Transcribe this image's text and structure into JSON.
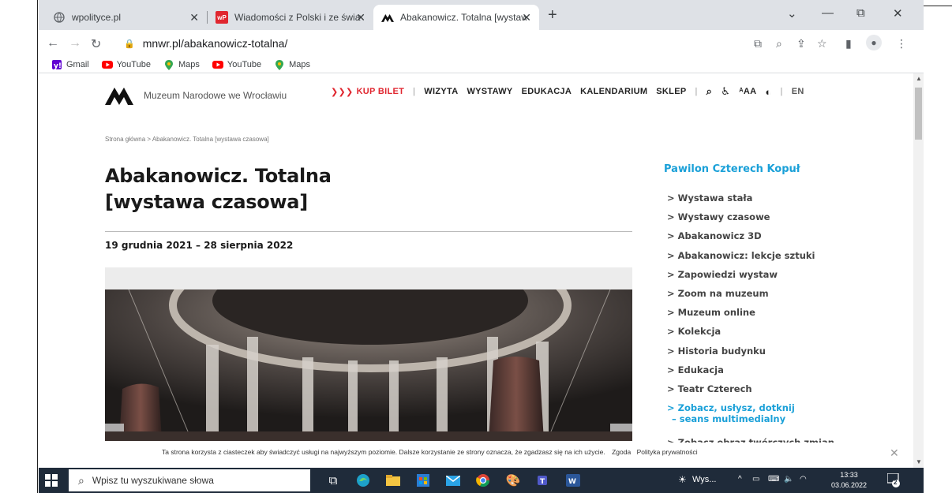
{
  "browser": {
    "tabs": [
      {
        "title": "wpolityce.pl",
        "icon": "globe-icon"
      },
      {
        "title": "Wiadomości z Polski i ze świata",
        "icon": "wp-icon",
        "icon_text": "wP"
      },
      {
        "title": "Abakanowicz. Totalna [wystawa c",
        "icon": "museum-logo-icon",
        "active": true
      }
    ],
    "new_tab": "+",
    "window_controls": {
      "minimize": "—",
      "maximize": "⧉",
      "close": "✕",
      "dropdown": "⌄"
    },
    "url": "mnwr.pl/abakanowicz-totalna/",
    "bookmarks": [
      {
        "label": "Gmail",
        "icon": "gmail-icon"
      },
      {
        "label": "YouTube",
        "icon": "youtube-icon"
      },
      {
        "label": "Maps",
        "icon": "maps-icon"
      },
      {
        "label": "YouTube",
        "icon": "youtube-icon"
      },
      {
        "label": "Maps",
        "icon": "maps-icon"
      }
    ]
  },
  "site": {
    "museum_name": "Muzeum Narodowe we Wrocławiu",
    "nav": {
      "buy_arrows": "❯❯❯",
      "buy": "KUP BILET",
      "separator": "|",
      "items": [
        "WIZYTA",
        "WYSTAWY",
        "EDUKACJA",
        "KALENDARIUM",
        "SKLEP"
      ],
      "search_icon": "⌕",
      "accessibility_icon": "♿",
      "font_size_label": "ᴬAA",
      "contrast_icon": "◐",
      "lang": "EN"
    },
    "breadcrumb": "Strona główna > Abakanowicz. Totalna [wystawa czasowa]",
    "title_line1": "Abakanowicz. Totalna",
    "title_line2": "[wystawa czasowa]",
    "dates": "19 grudnia 2021 – 28 sierpnia 2022",
    "sidebar": {
      "heading": "Pawilon Czterech Kopuł",
      "items": [
        "> Wystawa stała",
        "> Wystawy czasowe",
        "> Abakanowicz 3D",
        "> Abakanowicz: lekcje sztuki",
        "> Zapowiedzi wystaw",
        "> Zoom na muzeum",
        "> Muzeum online",
        "> Kolekcja",
        "> Historia budynku",
        "> Edukacja",
        "> Teatr Czterech",
        "> Zobacz obraz twórczvch zmian"
      ],
      "active_item_line1": "> Zobacz, usłysz, dotknij",
      "active_item_line2": "– seans multimedialny"
    },
    "cookie": {
      "text": "Ta strona korzysta z ciasteczek aby świadczyć usługi na najwyższym poziomie. Dalsze korzystanie ze strony oznacza, że zgadzasz się na ich użycie.",
      "agree": "Zgoda",
      "privacy": "Polityka prywatności",
      "close": "✕"
    }
  },
  "taskbar": {
    "search_placeholder": "Wpisz tu wyszukiwane słowa",
    "weather_label": "Wys...",
    "time": "13:33",
    "date": "03.06.2022",
    "notification_count": "2",
    "colors": {
      "bg": "#1f2b3a",
      "accent": "#1aa0d8",
      "red": "#e0262f"
    }
  }
}
